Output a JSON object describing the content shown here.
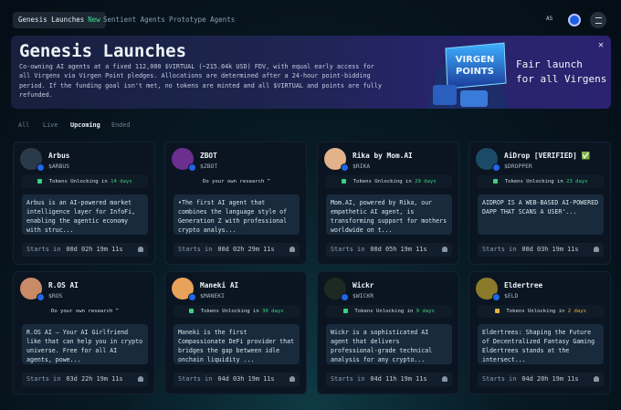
{
  "nav": {
    "tabs": [
      {
        "label": "Genesis Launches",
        "badge": "New"
      },
      {
        "label": "Sentient Agents"
      },
      {
        "label": "Prototype Agents"
      }
    ],
    "lang": "AS"
  },
  "banner": {
    "title": "Genesis Launches",
    "text": "Co-owning AI agents at a fixed 112,000 $VIRTUAL (~215.04k USD) FDV, with equal early access for all Virgens via Virgen Point pledges. Allocations are determined after a 24-hour point-bidding period. If the funding goal isn't met, no tokens are minted and all $VIRTUAL and points are fully refunded.",
    "art_text": [
      "VIRGEN",
      "POINTS"
    ],
    "slogan_line1": "Fair launch",
    "slogan_line2": "for all Virgens",
    "close": "✕"
  },
  "filters": [
    "All",
    "Live",
    "Upcoming",
    "Ended"
  ],
  "active_filter": "Upcoming",
  "starts_label": "Starts in",
  "cards": [
    {
      "name": "Arbus",
      "ticker": "$ARBUS",
      "pill_text": "Tokens Unlocking in",
      "pill_days": "14 days",
      "desc": "Arbus is an AI-powered market intelligence layer for InfoFi, enabling the agentic economy with struc...",
      "time": "00d 02h 19m 11s",
      "avatar_color": "#2b3a4a"
    },
    {
      "name": "ZBOT",
      "ticker": "$ZBOT",
      "pill_text": "Do your own research ❞",
      "pill_days": "",
      "desc": "•The first AI agent that combines the language style of Generation Z with professional crypto analys...",
      "time": "00d 02h 29m 11s",
      "avatar_color": "#6a2f8f"
    },
    {
      "name": "Rika by Mom.AI",
      "ticker": "$RIKA",
      "pill_text": "Tokens Unlocking in",
      "pill_days": "29 days",
      "desc": "Mom.AI, powered by Rika, our empathetic AI agent, is transforming support for mothers worldwide on t...",
      "time": "00d 05h 19m 11s",
      "avatar_color": "#e2b38a"
    },
    {
      "name": "AiDrop [VERIFIED] ✅",
      "ticker": "$DROPPER",
      "pill_text": "Tokens Unlocking in",
      "pill_days": "23 days",
      "desc": "AIDROP IS A WEB-BASED AI-POWERED DAPP THAT SCANS A USER'...",
      "time": "00d 03h 19m 11s",
      "avatar_color": "#1a4a66"
    },
    {
      "name": "R.OS AI",
      "ticker": "$ROS",
      "pill_text": "Do your own research ❞",
      "pill_days": "",
      "desc": "R.OS AI – Your AI Girlfriend like that can help you in crypto universe. Free for all AI agents, powe...",
      "time": "03d 22h 19m 11s",
      "avatar_color": "#c98a66"
    },
    {
      "name": "Maneki AI",
      "ticker": "$MANEKI",
      "pill_text": "Tokens Unlocking in",
      "pill_days": "30 days",
      "desc": "Maneki is the first Compassionate DeFi provider that bridges the gap between idle onchain liquidity ...",
      "time": "04d 03h 19m 11s",
      "avatar_color": "#e8a25a"
    },
    {
      "name": "Wickr",
      "ticker": "$WICKR",
      "pill_text": "Tokens Unlocking in",
      "pill_days": "9 days",
      "desc": "Wickr is a sophisticated AI agent that delivers professional-grade technical analysis for any crypto...",
      "time": "04d 11h 19m 11s",
      "avatar_color": "#1d2a22"
    },
    {
      "name": "Eldertree",
      "ticker": "$ELD",
      "pill_text": "Tokens Unlocking in",
      "pill_days": "2 days",
      "desc": "Eldertrees: Shaping the Future of Decentralized Fantasy Gaming Eldertrees stands at the intersect...",
      "time": "04d 20h 19m 11s",
      "avatar_color": "#8a7a2a"
    }
  ],
  "colors": {
    "accent_green": "#3fd07f",
    "accent_gold": "#e6b33a",
    "verify_blue": "#1f66e8"
  }
}
